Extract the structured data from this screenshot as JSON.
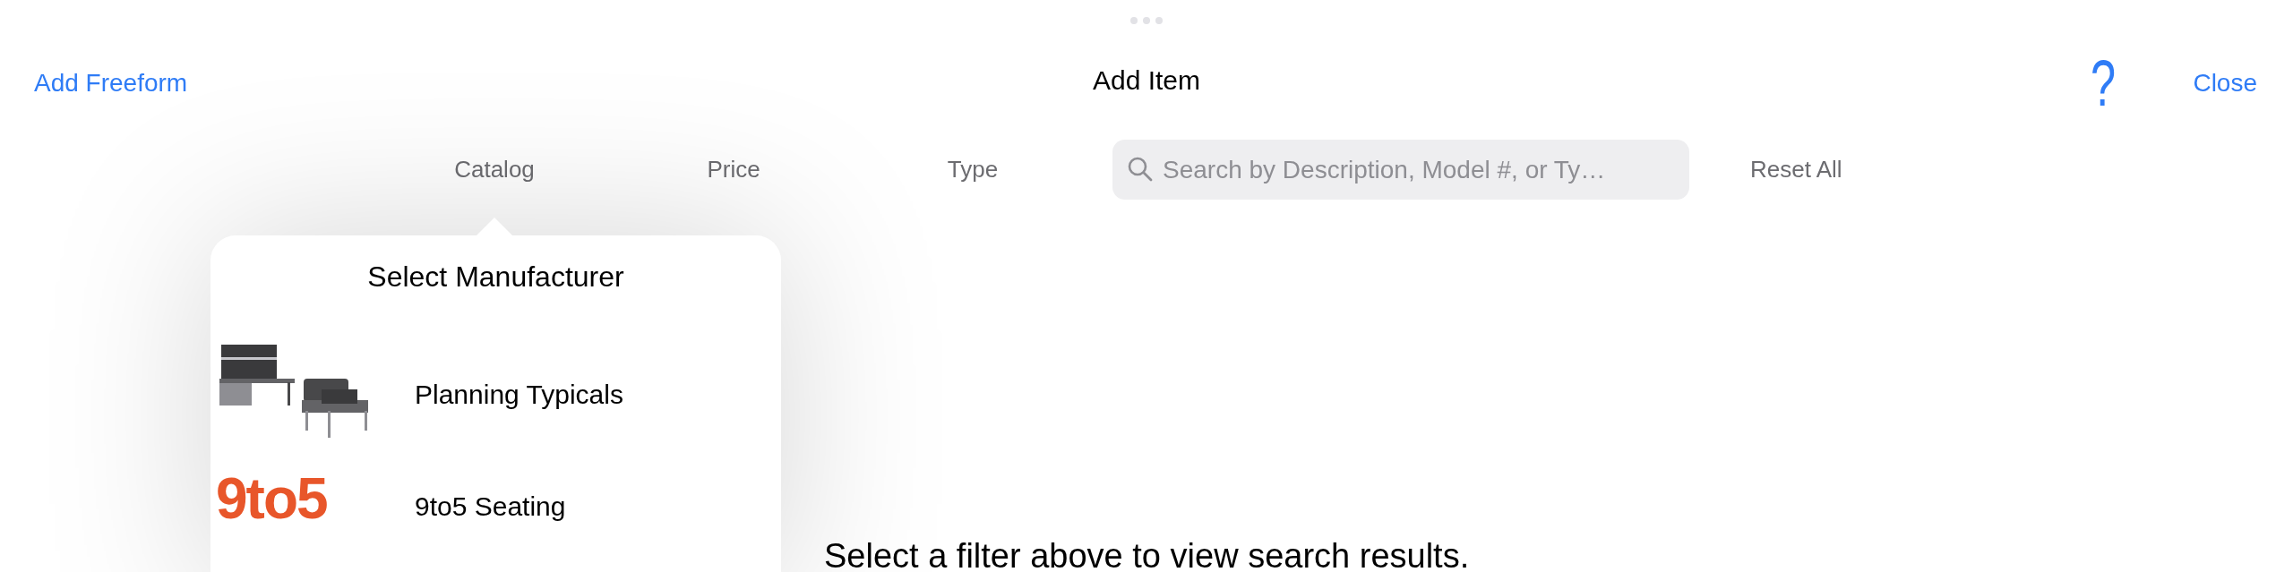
{
  "window": {
    "title": "Add Item"
  },
  "nav": {
    "left_button": "Add Freeform",
    "help": "?",
    "right_button": "Close"
  },
  "filters": [
    {
      "label": "Catalog"
    },
    {
      "label": "Price"
    },
    {
      "label": "Type"
    }
  ],
  "search": {
    "placeholder": "Search by Description, Model #, or Ty…"
  },
  "reset": "Reset All",
  "popover": {
    "title": "Select Manufacturer",
    "items": [
      {
        "name": "Planning Typicals"
      },
      {
        "name": "9to5 Seating",
        "thumb": {
          "kind": "logo",
          "text": "9to5"
        }
      }
    ]
  },
  "message": "Select a filter above to view search results."
}
